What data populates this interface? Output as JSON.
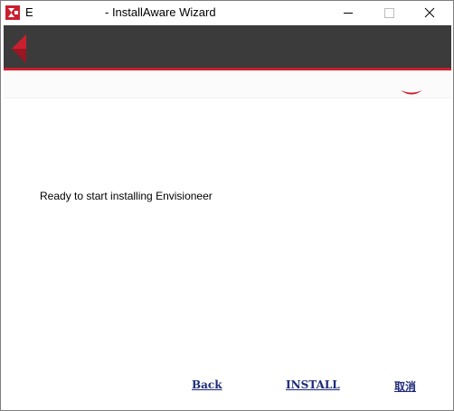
{
  "window": {
    "title_prefix": "E",
    "title": "- InstallAware Wizard",
    "app_icon": "installaware-app-icon"
  },
  "caption_buttons": {
    "minimize": "minimize-icon",
    "maximize": "maximize-icon",
    "close": "close-icon"
  },
  "banner": {
    "arrow_icon": "back-arrow-icon",
    "background": "#3b3b3b",
    "accent_color": "#c9202f"
  },
  "content": {
    "status_text": "Ready to start installing Envisioneer"
  },
  "buttons": {
    "back": "Back",
    "install": "INSTALL",
    "cancel": "取消"
  },
  "colors": {
    "link": "#1f2a7a"
  }
}
